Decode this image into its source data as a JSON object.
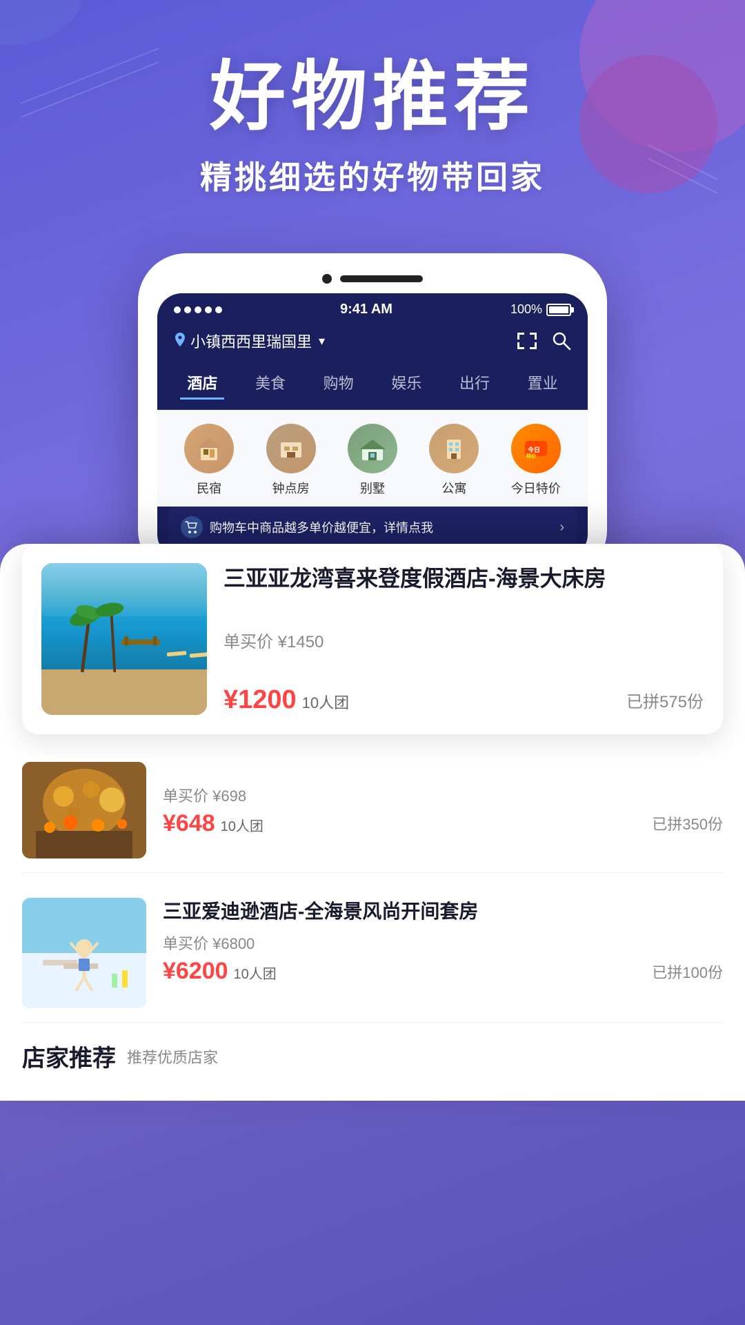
{
  "app": {
    "header": {
      "main_title": "好物推荐",
      "sub_title": "精挑细选的好物带回家"
    },
    "status_bar": {
      "signal_dots": 5,
      "time": "9:41 AM",
      "battery": "100%"
    },
    "location_bar": {
      "pin_icon": "location-pin",
      "location_text": "小镇西西里瑞国里",
      "chevron_icon": "chevron-down",
      "scan_icon": "scan-icon",
      "search_icon": "search-icon"
    },
    "nav_tabs": [
      {
        "label": "酒店",
        "active": true
      },
      {
        "label": "美食",
        "active": false
      },
      {
        "label": "购物",
        "active": false
      },
      {
        "label": "娱乐",
        "active": false
      },
      {
        "label": "出行",
        "active": false
      },
      {
        "label": "置业",
        "active": false
      }
    ],
    "categories": [
      {
        "label": "民宿",
        "type": "minshu"
      },
      {
        "label": "钟点房",
        "type": "zhongdian"
      },
      {
        "label": "别墅",
        "type": "bieshu"
      },
      {
        "label": "公寓",
        "type": "gongyu"
      },
      {
        "label": "今日特价",
        "type": "special"
      }
    ],
    "promo_banner": {
      "text": "购物车中商品越多单价越便宜，详情点我",
      "arrow": "›"
    },
    "products": [
      {
        "id": 1,
        "name": "三亚亚龙湾喜来登度假酒店-海景大床房",
        "original_price": "单买价 ¥1450",
        "group_price": "¥1200",
        "group_size": "10人团",
        "joined": "已拼575份",
        "image_type": "pool"
      },
      {
        "id": 2,
        "name": "",
        "original_price": "单买价 ¥698",
        "group_price": "¥648",
        "group_size": "10人团",
        "joined": "已拼350份",
        "image_type": "food"
      },
      {
        "id": 3,
        "name": "三亚爱迪逊酒店-全海景风尚开间套房",
        "original_price": "单买价 ¥6800",
        "group_price": "¥6200",
        "group_size": "10人团",
        "joined": "已拼100份",
        "image_type": "beach"
      }
    ],
    "shop_section": {
      "title": "店家推荐",
      "subtitle": "推荐优质店家"
    }
  }
}
